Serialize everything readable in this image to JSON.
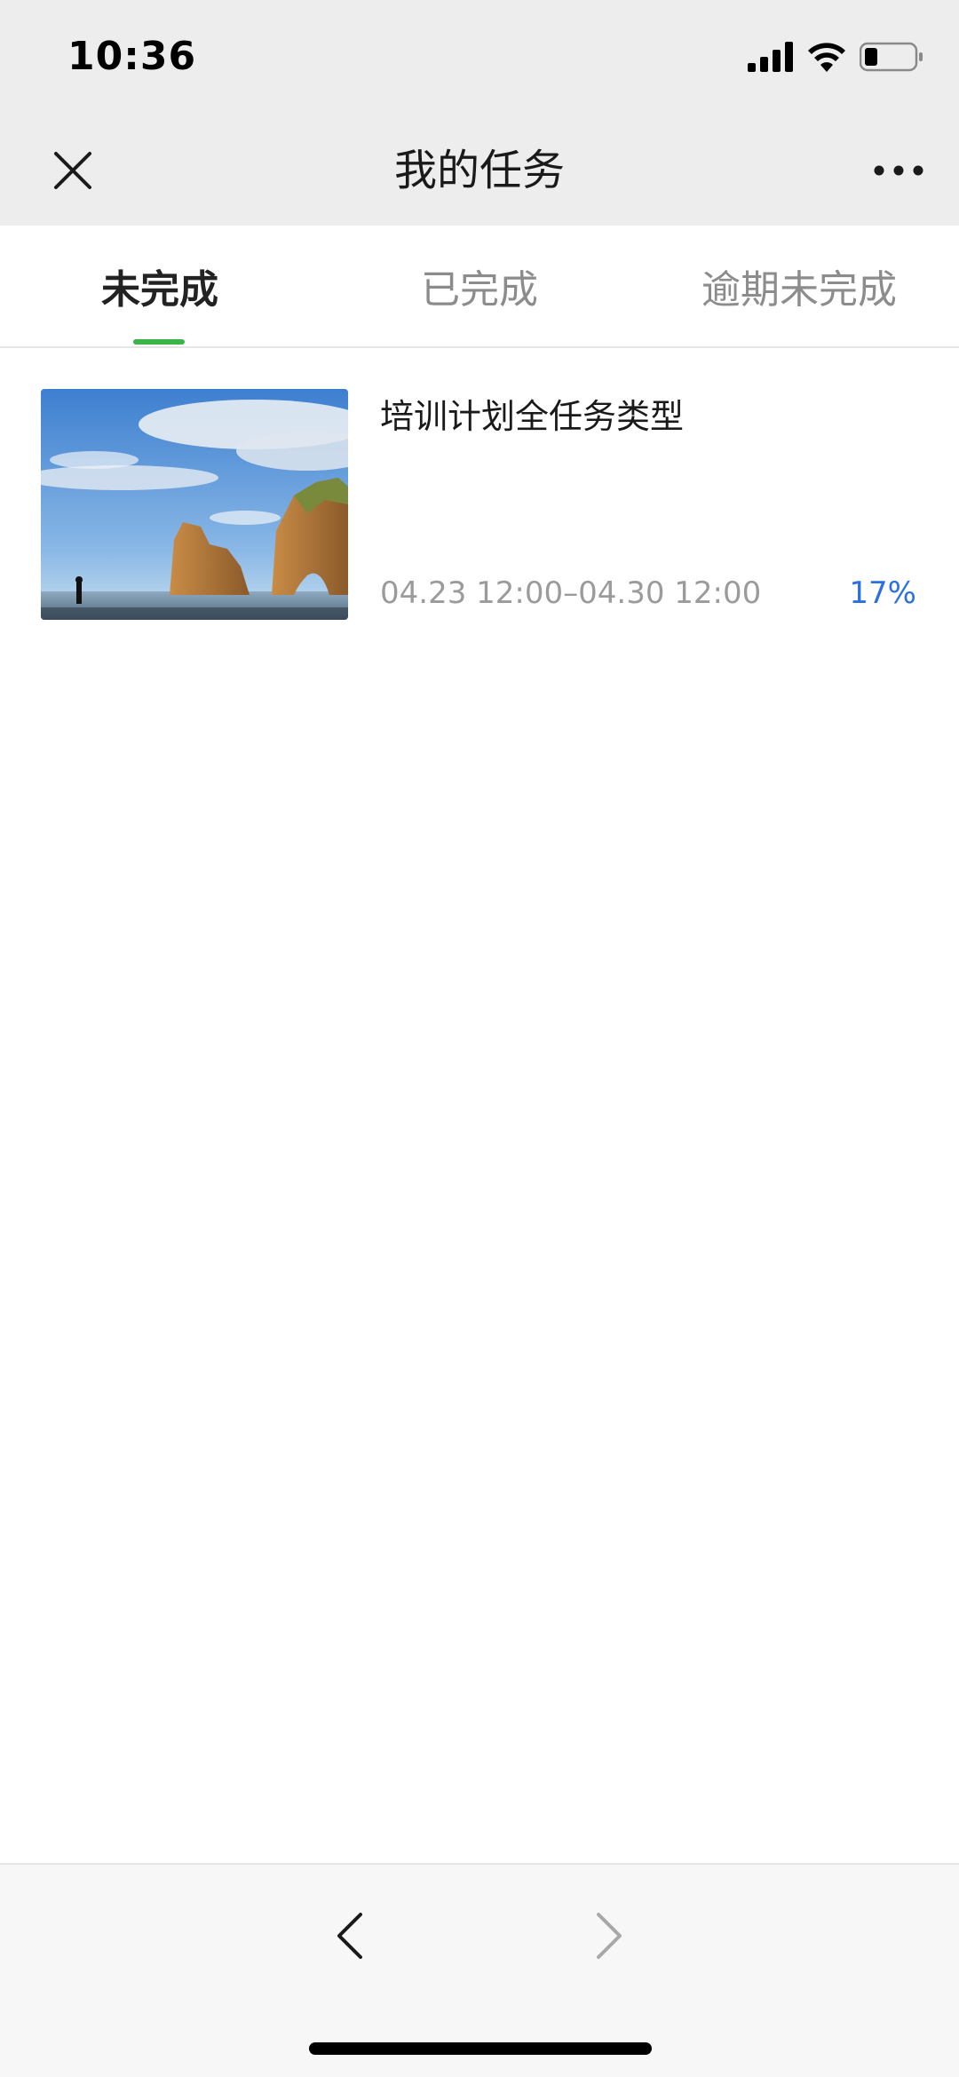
{
  "status_bar": {
    "time": "10:36",
    "icons": [
      "signal-icon",
      "wifi-icon",
      "battery-icon"
    ]
  },
  "nav": {
    "title": "我的任务",
    "close_icon": "close-icon",
    "more_icon": "more-icon"
  },
  "tabs": [
    {
      "label": "未完成",
      "active": true
    },
    {
      "label": "已完成",
      "active": false
    },
    {
      "label": "逾期未完成",
      "active": false
    }
  ],
  "tasks": [
    {
      "title": "培训计划全任务类型",
      "time_range": "04.23 12:00–04.30 12:00",
      "progress": "17%"
    }
  ],
  "bottom_bar": {
    "back_icon": "chevron-left-icon",
    "forward_icon": "chevron-right-icon"
  },
  "colors": {
    "accent_green": "#3bb44a",
    "progress_blue": "#2b6fe0",
    "header_bg": "#ededed"
  }
}
